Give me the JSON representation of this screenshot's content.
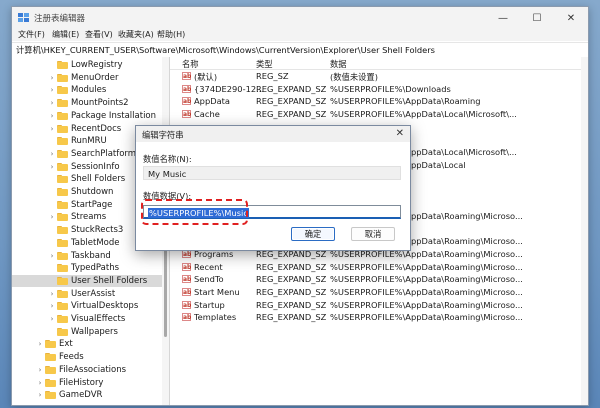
{
  "window": {
    "title": "注册表编辑器",
    "minimize": "—",
    "maximize": "☐",
    "close": "✕"
  },
  "menu": [
    "文件(F)",
    "编辑(E)",
    "查看(V)",
    "收藏夹(A)",
    "帮助(H)"
  ],
  "address": "计算机\\HKEY_CURRENT_USER\\Software\\Microsoft\\Windows\\CurrentVersion\\Explorer\\User Shell Folders",
  "tree": {
    "items": [
      {
        "label": "LowRegistry",
        "chevron": "",
        "level": 2
      },
      {
        "label": "MenuOrder",
        "chevron": "›",
        "level": 2
      },
      {
        "label": "Modules",
        "chevron": "›",
        "level": 2
      },
      {
        "label": "MountPoints2",
        "chevron": "›",
        "level": 2
      },
      {
        "label": "Package Installation",
        "chevron": "›",
        "level": 2
      },
      {
        "label": "RecentDocs",
        "chevron": "›",
        "level": 2
      },
      {
        "label": "RunMRU",
        "chevron": "",
        "level": 2
      },
      {
        "label": "SearchPlatform",
        "chevron": "›",
        "level": 2
      },
      {
        "label": "SessionInfo",
        "chevron": "›",
        "level": 2
      },
      {
        "label": "Shell Folders",
        "chevron": "",
        "level": 2
      },
      {
        "label": "Shutdown",
        "chevron": "",
        "level": 2
      },
      {
        "label": "StartPage",
        "chevron": "",
        "level": 2
      },
      {
        "label": "Streams",
        "chevron": "›",
        "level": 2
      },
      {
        "label": "StuckRects3",
        "chevron": "",
        "level": 2
      },
      {
        "label": "TabletMode",
        "chevron": "",
        "level": 2
      },
      {
        "label": "Taskband",
        "chevron": "›",
        "level": 2
      },
      {
        "label": "TypedPaths",
        "chevron": "",
        "level": 2
      },
      {
        "label": "User Shell Folders",
        "chevron": "",
        "level": 2,
        "selected": true
      },
      {
        "label": "UserAssist",
        "chevron": "›",
        "level": 2
      },
      {
        "label": "VirtualDesktops",
        "chevron": "›",
        "level": 2
      },
      {
        "label": "VisualEffects",
        "chevron": "›",
        "level": 2
      },
      {
        "label": "Wallpapers",
        "chevron": "",
        "level": 2
      },
      {
        "label": "Ext",
        "chevron": "›",
        "level": 1
      },
      {
        "label": "Feeds",
        "chevron": "",
        "level": 1
      },
      {
        "label": "FileAssociations",
        "chevron": "›",
        "level": 1
      },
      {
        "label": "FileHistory",
        "chevron": "›",
        "level": 1
      },
      {
        "label": "GameDVR",
        "chevron": "›",
        "level": 1
      }
    ]
  },
  "list": {
    "headers": {
      "name": "名称",
      "type": "类型",
      "data": "数据"
    },
    "rows": [
      {
        "name": "(默认)",
        "type": "REG_SZ",
        "data": "(数值未设置)"
      },
      {
        "name": "{374DE290-12...",
        "type": "REG_EXPAND_SZ",
        "data": "%USERPROFILE%\\Downloads"
      },
      {
        "name": "AppData",
        "type": "REG_EXPAND_SZ",
        "data": "%USERPROFILE%\\AppData\\Roaming"
      },
      {
        "name": "Cache",
        "type": "REG_EXPAND_SZ",
        "data": "%USERPROFILE%\\AppData\\Local\\Microsoft\\..."
      },
      {
        "name": "",
        "type": "",
        "data": "p"
      },
      {
        "name": "",
        "type": "",
        "data": "es"
      },
      {
        "name": "",
        "type": "",
        "data": "%USERPROFILE%\\AppData\\Local\\Microsoft\\..."
      },
      {
        "name": "",
        "type": "",
        "data": "%USERPROFILE%\\AppData\\Local"
      },
      {
        "name": "",
        "type": "",
        "data": ""
      },
      {
        "name": "",
        "type": "",
        "data": "s"
      },
      {
        "name": "",
        "type": "",
        "data": ""
      },
      {
        "name": "",
        "type": "",
        "data": "%USERPROFILE%\\AppData\\Roaming\\Microso..."
      },
      {
        "name": "",
        "type": "",
        "data": "ents"
      },
      {
        "name": "PrintHood",
        "type": "REG_EXPAND_SZ",
        "data": "%USERPROFILE%\\AppData\\Roaming\\Microso..."
      },
      {
        "name": "Programs",
        "type": "REG_EXPAND_SZ",
        "data": "%USERPROFILE%\\AppData\\Roaming\\Microso..."
      },
      {
        "name": "Recent",
        "type": "REG_EXPAND_SZ",
        "data": "%USERPROFILE%\\AppData\\Roaming\\Microso..."
      },
      {
        "name": "SendTo",
        "type": "REG_EXPAND_SZ",
        "data": "%USERPROFILE%\\AppData\\Roaming\\Microso..."
      },
      {
        "name": "Start Menu",
        "type": "REG_EXPAND_SZ",
        "data": "%USERPROFILE%\\AppData\\Roaming\\Microso..."
      },
      {
        "name": "Startup",
        "type": "REG_EXPAND_SZ",
        "data": "%USERPROFILE%\\AppData\\Roaming\\Microso..."
      },
      {
        "name": "Templates",
        "type": "REG_EXPAND_SZ",
        "data": "%USERPROFILE%\\AppData\\Roaming\\Microso..."
      }
    ]
  },
  "dialog": {
    "title": "编辑字符串",
    "close": "✕",
    "name_label": "数值名称(N):",
    "name_value": "My Music",
    "data_label": "数值数据(V):",
    "data_value": "%USERPROFILE%\\Music",
    "ok": "确定",
    "cancel": "取消"
  }
}
